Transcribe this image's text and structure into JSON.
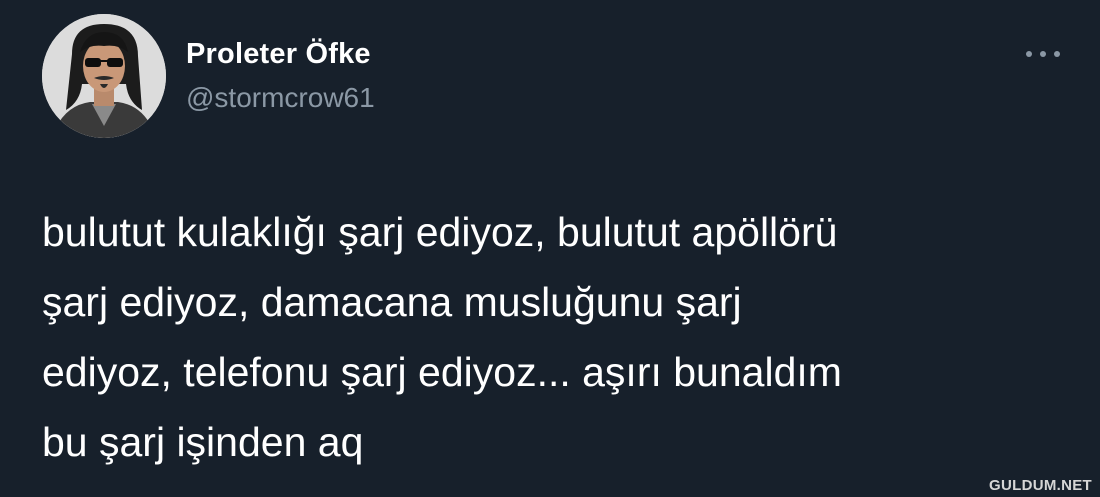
{
  "author": {
    "display_name": "Proleter Öfke",
    "handle": "@stormcrow61",
    "avatar_icon": "user-avatar-photo"
  },
  "more_icon": "more-horizontal-icon",
  "tweet": {
    "text": "bulutut kulaklığı şarj ediyoz, bulutut apöllörü\nşarj ediyoz, damacana musluğunu şarj\nediyoz, telefonu şarj ediyoz... aşırı bunaldım\nbu şarj işinden aq"
  },
  "watermark": {
    "text": "GULDUM.NET"
  },
  "colors": {
    "background": "#17202b",
    "primary_text": "#ffffff",
    "secondary_text": "#8b98a5"
  }
}
